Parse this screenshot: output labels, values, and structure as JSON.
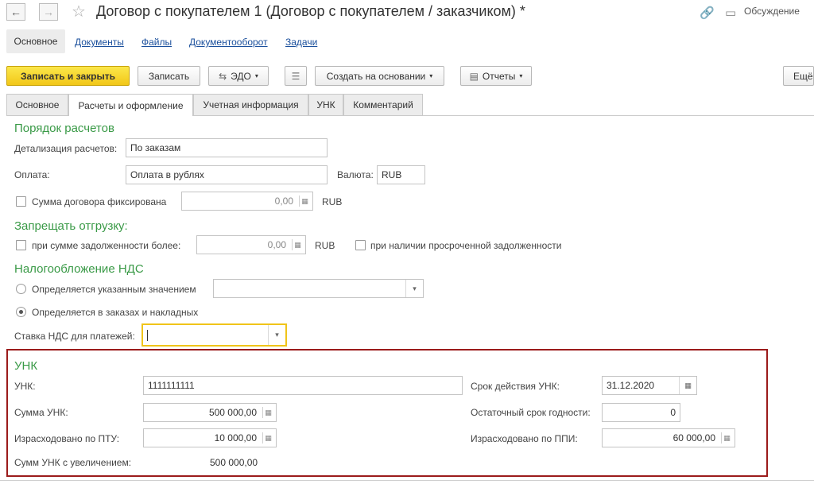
{
  "window": {
    "title": "Договор с покупателем 1 (Договор с покупателем / заказчиком) *",
    "discussion_label": "Обсуждение"
  },
  "nav_links": [
    "Основное",
    "Документы",
    "Файлы",
    "Документооборот",
    "Задачи"
  ],
  "toolbar": {
    "save_close": "Записать и закрыть",
    "save": "Записать",
    "edo": "ЭДО",
    "create_based": "Создать на основании",
    "reports": "Отчеты",
    "more": "Ещё"
  },
  "tabs": [
    "Основное",
    "Расчеты и оформление",
    "Учетная информация",
    "УНК",
    "Комментарий"
  ],
  "payment": {
    "section": "Порядок расчетов",
    "detail_label": "Детализация расчетов:",
    "detail_value": "По заказам",
    "payment_label": "Оплата:",
    "payment_value": "Оплата в рублях",
    "currency_label": "Валюта:",
    "currency_value": "RUB",
    "fixed_label": "Сумма договора фиксирована",
    "fixed_value": "0,00",
    "fixed_currency": "RUB"
  },
  "shipment": {
    "section": "Запрещать отгрузку:",
    "debt_label": "при сумме задолженности более:",
    "debt_value": "0,00",
    "debt_currency": "RUB",
    "overdue_label": "при наличии просроченной задолженности"
  },
  "vat": {
    "section": "Налогообложение НДС",
    "option1": "Определяется указанным значением",
    "option2": "Определяется в заказах и накладных",
    "rate_label": "Ставка НДС для платежей:",
    "rate_value": ""
  },
  "unk": {
    "section": "УНК",
    "unk_label": "УНК:",
    "unk_value": "1111111111",
    "term_label": "Срок действия УНК:",
    "term_value": "31.12.2020",
    "sum_label": "Сумма УНК:",
    "sum_value": "500 000,00",
    "remaining_label": "Остаточный срок годности:",
    "remaining_value": "0",
    "spent_ptu_label": "Израсходовано по ПТУ:",
    "spent_ptu_value": "10 000,00",
    "spent_ppi_label": "Израсходовано по ППИ:",
    "spent_ppi_value": "60 000,00",
    "sum_increase_label": "Сумм УНК с увеличением:",
    "sum_increase_value": "500 000,00"
  },
  "colors": {
    "section_green": "#3a9a47",
    "link_blue": "#1a4f9c",
    "primary_yellow": "#f5d328",
    "highlight_red": "#9b1b1b",
    "focus_yellow": "#f0c419"
  }
}
